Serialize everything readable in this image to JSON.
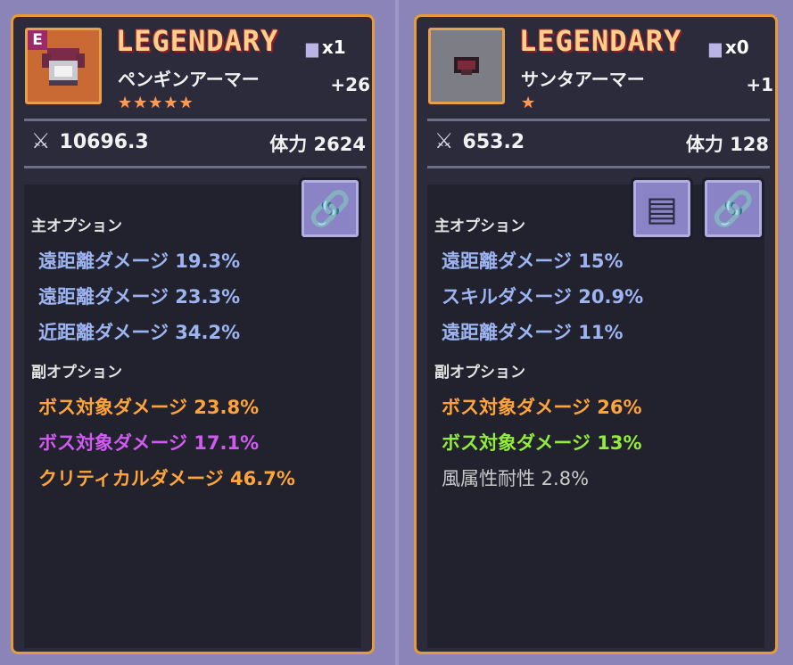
{
  "cards": [
    {
      "badge": "E",
      "rarity": "LEGENDARY",
      "name": "ペンギンアーマー",
      "stars": "★★★★★",
      "count": "x1",
      "enhance": "+26",
      "attack": "10696.3",
      "hp_label": "体力",
      "hp_value": "2624",
      "main_label": "主オプション",
      "main_options": [
        "遠距離ダメージ  19.3%",
        "遠距離ダメージ  23.3%",
        "近距離ダメージ  34.2%"
      ],
      "sub_label": "副オプション",
      "sub_options": [
        "ボス対象ダメージ  23.8%",
        "ボス対象ダメージ  17.1%",
        "クリティカルダメージ  46.7%"
      ]
    },
    {
      "rarity": "LEGENDARY",
      "name": "サンタアーマー",
      "stars": "★",
      "count": "x0",
      "enhance": "+1",
      "attack": "653.2",
      "hp_label": "体力",
      "hp_value": "128",
      "main_label": "主オプション",
      "main_options": [
        "遠距離ダメージ  15%",
        "スキルダメージ  20.9%",
        "遠距離ダメージ  11%"
      ],
      "sub_label": "副オプション",
      "sub_options": [
        "ボス対象ダメージ  26%",
        "ボス対象ダメージ  13%",
        "風属性耐性  2.8%"
      ]
    }
  ],
  "icons": {
    "armor_count": "anvil-icon",
    "attack": "sword-icon",
    "link": "chain-link-icon",
    "skill": "skill-book-icon"
  },
  "colors": {
    "frame": "#e49a3d",
    "panel": "#2b2b3b",
    "blue_option": "#9db4f2",
    "orange_option": "#ffa43a",
    "purple_option": "#d05af2",
    "green_option": "#92ec3a"
  }
}
